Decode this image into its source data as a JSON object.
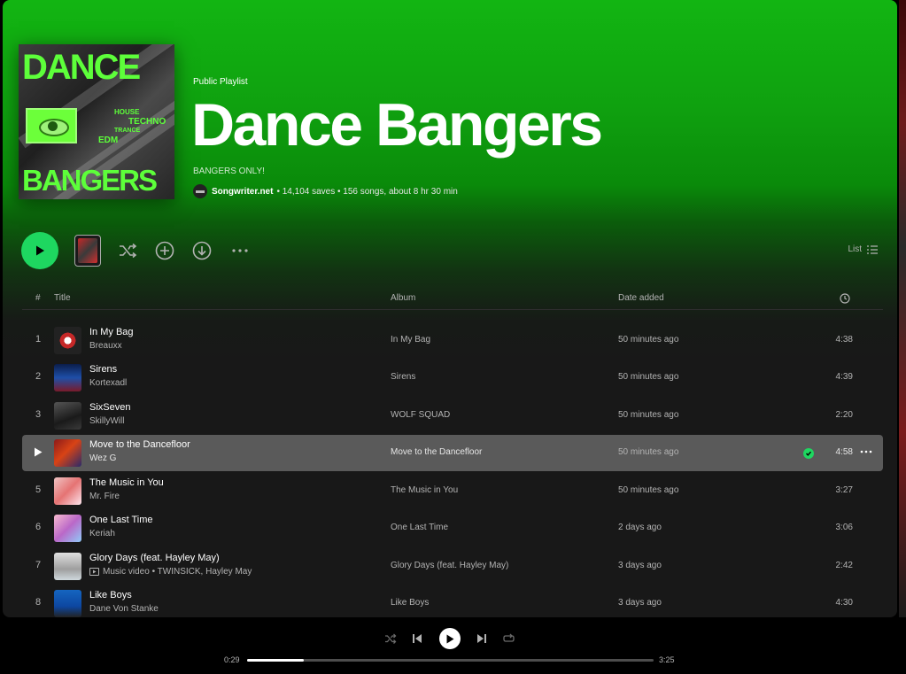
{
  "header": {
    "type_label": "Public Playlist",
    "title": "Dance Bangers",
    "description": "BANGERS ONLY!",
    "owner": "Songwriter.net",
    "meta": "• 14,104 saves • 156 songs, about 8 hr 30 min",
    "cover": {
      "line1": "DANCE",
      "line2": "BANGERS",
      "tag_house": "HOUSE",
      "tag_techno": "TECHNO",
      "tag_trance": "TRANCE",
      "tag_edm": "EDM"
    }
  },
  "toolbar": {
    "view_label": "List"
  },
  "table": {
    "col_num": "#",
    "col_title": "Title",
    "col_album": "Album",
    "col_date": "Date added"
  },
  "tracks": [
    {
      "num": "1",
      "title": "In My Bag",
      "artist": "Breauxx",
      "album": "In My Bag",
      "date": "50 minutes ago",
      "duration": "4:38"
    },
    {
      "num": "2",
      "title": "Sirens",
      "artist": "Kortexadl",
      "album": "Sirens",
      "date": "50 minutes ago",
      "duration": "4:39"
    },
    {
      "num": "3",
      "title": "SixSeven",
      "artist": "SkillyWill",
      "album": "WOLF SQUAD",
      "date": "50 minutes ago",
      "duration": "2:20"
    },
    {
      "num": "4",
      "title": "Move to the Dancefloor",
      "artist": "Wez G",
      "album": "Move to the Dancefloor",
      "date": "50 minutes ago",
      "duration": "4:58"
    },
    {
      "num": "5",
      "title": "The Music in You",
      "artist": "Mr. Fire",
      "album": "The Music in You",
      "date": "50 minutes ago",
      "duration": "3:27"
    },
    {
      "num": "6",
      "title": "One Last Time",
      "artist": "Keriah",
      "album": "One Last Time",
      "date": "2 days ago",
      "duration": "3:06"
    },
    {
      "num": "7",
      "title": "Glory Days (feat. Hayley May)",
      "artist": "Music video • TWINSICK, Hayley May",
      "album": "Glory Days (feat. Hayley May)",
      "date": "3 days ago",
      "duration": "2:42"
    },
    {
      "num": "8",
      "title": "Like Boys",
      "artist": "Dane Von Stanke",
      "album": "Like Boys",
      "date": "3 days ago",
      "duration": "4:30"
    }
  ],
  "player": {
    "elapsed": "0:29",
    "total": "3:25",
    "progress_fraction": 0.14
  },
  "colors": {
    "accent": "#1ed760",
    "header_green": "#12b512",
    "background": "#181818"
  }
}
